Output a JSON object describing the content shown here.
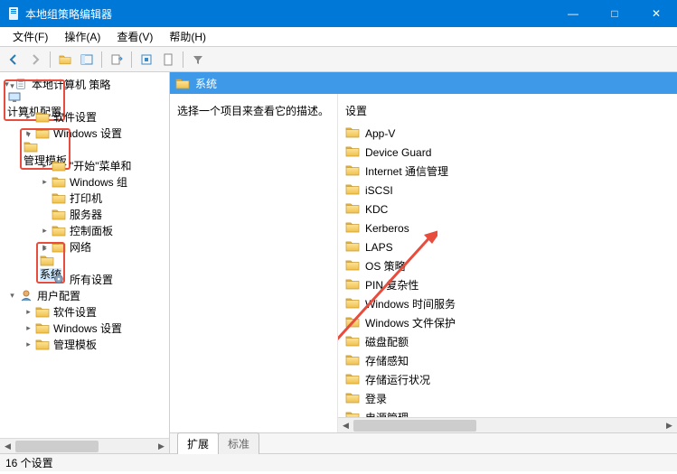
{
  "window": {
    "title": "本地组策略编辑器",
    "minimize": "—",
    "maximize": "□",
    "close": "✕"
  },
  "menu": {
    "file": "文件(F)",
    "action": "操作(A)",
    "view": "查看(V)",
    "help": "帮助(H)"
  },
  "tree": {
    "root": "本地计算机 策略",
    "computer_config": "计算机配置",
    "software_settings": "软件设置",
    "windows_settings": "Windows 设置",
    "admin_templates": "管理模板",
    "start_menu": "\"开始\"菜单和",
    "windows_components": "Windows 组",
    "printers": "打印机",
    "server": "服务器",
    "control_panel": "控制面板",
    "network": "网络",
    "system": "系统",
    "all_settings": "所有设置",
    "user_config": "用户配置",
    "u_software": "软件设置",
    "u_windows": "Windows 设置",
    "u_admin": "管理模板"
  },
  "rightpane": {
    "header": "系统",
    "description": "选择一个项目来查看它的描述。",
    "column_header": "设置",
    "items": [
      "App-V",
      "Device Guard",
      "Internet 通信管理",
      "iSCSI",
      "KDC",
      "Kerberos",
      "LAPS",
      "OS 策略",
      "PIN 复杂性",
      "Windows 时间服务",
      "Windows 文件保护",
      "磁盘配额",
      "存储感知",
      "存储运行状况",
      "登录",
      "电源管理"
    ]
  },
  "tabs": {
    "extended": "扩展",
    "standard": "标准"
  },
  "status": "16 个设置",
  "colors": {
    "accent": "#0078d7",
    "header": "#3e9ae8",
    "highlight": "#e74c3c"
  }
}
